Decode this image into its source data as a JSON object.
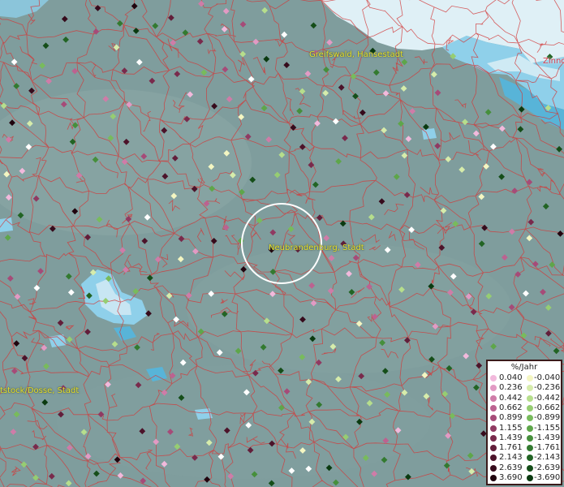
{
  "map": {
    "colors": {
      "land": "#7f9d9d",
      "land_light": "#94afad",
      "water": "#8fd0ea",
      "water_deep": "#58b4d8",
      "ice": "#dff0f6",
      "boundary": "#d23a3a"
    },
    "places": [
      {
        "id": "greifswald",
        "label": "Greifswald, Hansestadt",
        "style": "yellow"
      },
      {
        "id": "neubrandenburg",
        "label": "Neubrandenburg, Stadt",
        "style": "yellow"
      },
      {
        "id": "wittstock",
        "label": "tstock/Dosse, Stadt",
        "style": "yellow"
      },
      {
        "id": "zinnowitz",
        "label": "Zinno",
        "style": "red"
      }
    ],
    "selection_marker": "circle-around-neubrandenburg"
  },
  "legend": {
    "title": "%/Jahr",
    "rows": [
      {
        "pos": "0.040",
        "neg": "-0.040",
        "pos_color": "#f2b9dc",
        "neg_color": "#f4f6c2"
      },
      {
        "pos": "0.236",
        "neg": "-0.236",
        "pos_color": "#e29ac4",
        "neg_color": "#d6ecab"
      },
      {
        "pos": "0.442",
        "neg": "-0.442",
        "pos_color": "#cf7ca8",
        "neg_color": "#b6de8c"
      },
      {
        "pos": "0.662",
        "neg": "-0.662",
        "pos_color": "#bc6290",
        "neg_color": "#96cd72"
      },
      {
        "pos": "0.899",
        "neg": "-0.899",
        "pos_color": "#a64b78",
        "neg_color": "#78bb5c"
      },
      {
        "pos": "1.155",
        "neg": "-1.155",
        "pos_color": "#903a62",
        "neg_color": "#5ea64a"
      },
      {
        "pos": "1.439",
        "neg": "-1.439",
        "pos_color": "#792a4c",
        "neg_color": "#468f3c"
      },
      {
        "pos": "1.761",
        "neg": "-1.761",
        "pos_color": "#621e3a",
        "neg_color": "#337a30"
      },
      {
        "pos": "2.143",
        "neg": "-2.143",
        "pos_color": "#4c132a",
        "neg_color": "#226424"
      },
      {
        "pos": "2.639",
        "neg": "-2.639",
        "pos_color": "#360b1c",
        "neg_color": "#154e19"
      },
      {
        "pos": "3.690",
        "neg": "-3.690",
        "pos_color": "#20040e",
        "neg_color": "#0a3a10"
      }
    ]
  }
}
